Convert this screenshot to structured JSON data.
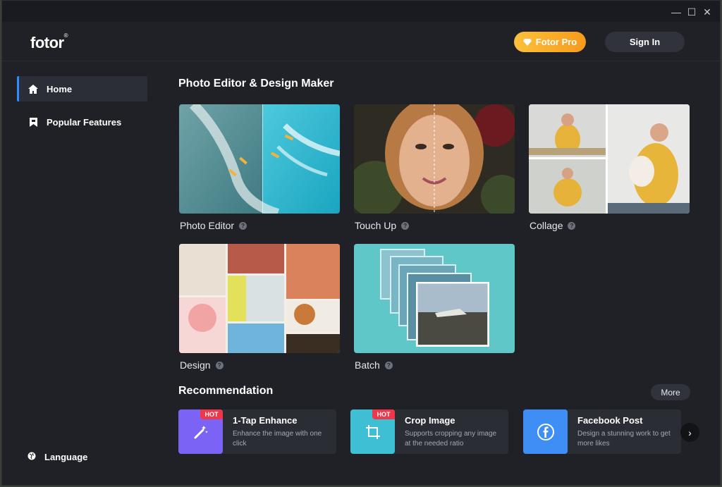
{
  "window": {
    "controls": {
      "minimize": "—",
      "maximize": "☐",
      "close": "✕"
    }
  },
  "header": {
    "logo": "fotor",
    "logo_mark": "®",
    "pro_label": "Fotor Pro",
    "signin_label": "Sign In"
  },
  "sidebar": {
    "items": [
      {
        "label": "Home",
        "icon": "home-icon",
        "active": true
      },
      {
        "label": "Popular Features",
        "icon": "bookmark-icon",
        "active": false
      }
    ],
    "language_label": "Language"
  },
  "main": {
    "title": "Photo Editor & Design Maker",
    "cards": [
      {
        "label": "Photo Editor"
      },
      {
        "label": "Touch Up"
      },
      {
        "label": "Collage"
      },
      {
        "label": "Design"
      },
      {
        "label": "Batch"
      }
    ],
    "recommendation": {
      "title": "Recommendation",
      "more_label": "More",
      "items": [
        {
          "title": "1-Tap Enhance",
          "desc": "Enhance the image with one click",
          "badge": "HOT",
          "color": "#7b63f5"
        },
        {
          "title": "Crop Image",
          "desc": "Supports cropping any image at the needed ratio",
          "badge": "HOT",
          "color": "#3ebfd4"
        },
        {
          "title": "Facebook Post",
          "desc": "Design a stunning work to get more likes",
          "badge": "",
          "color": "#3f8ef5"
        }
      ]
    },
    "help_glyph": "?",
    "next_glyph": "›"
  },
  "colors": {
    "accent": "#2f8cff",
    "pro_gradient_start": "#fbc13a",
    "pro_gradient_end": "#f79a1c",
    "hot": "#f0374a"
  }
}
